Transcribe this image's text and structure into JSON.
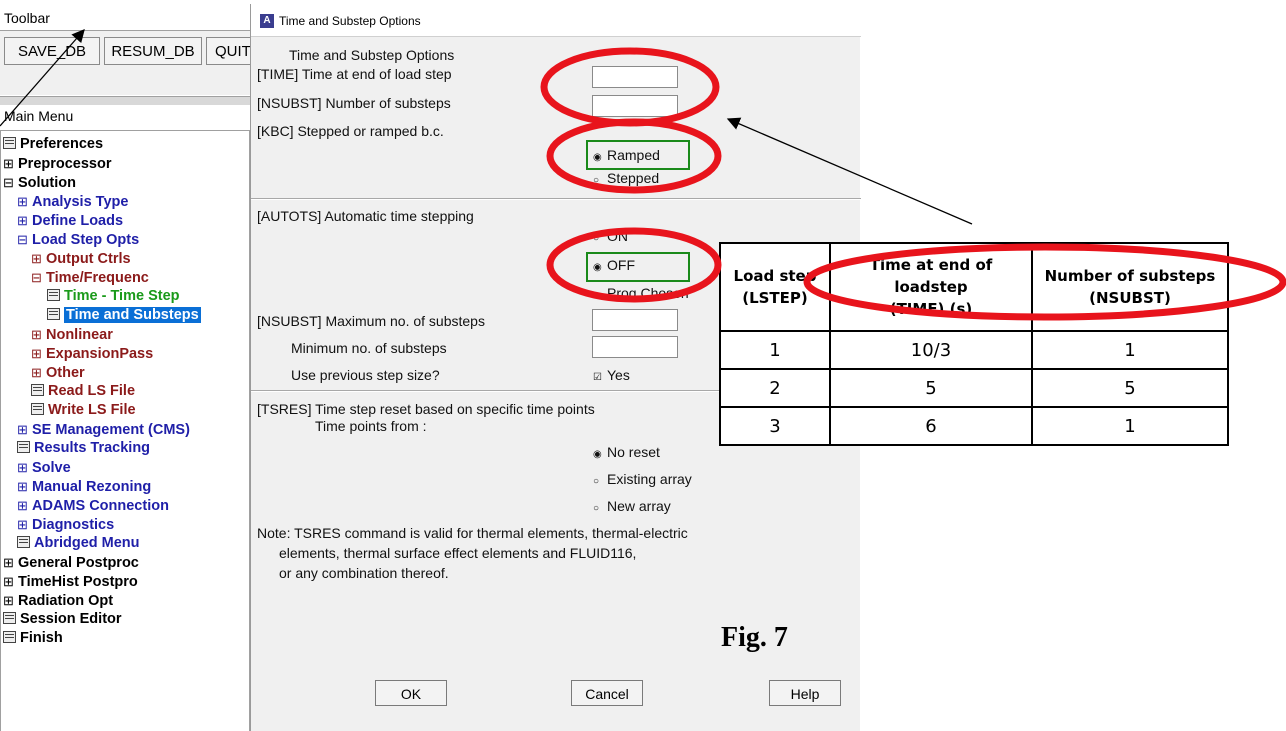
{
  "toolbar": {
    "title": "Toolbar",
    "buttons": [
      "SAVE_DB",
      "RESUM_DB",
      "QUIT"
    ]
  },
  "main_menu": {
    "title": "Main Menu",
    "items": [
      {
        "label": "Preferences"
      },
      {
        "label": "Preprocessor"
      },
      {
        "label": "Solution"
      },
      {
        "label": "Analysis Type"
      },
      {
        "label": "Define Loads"
      },
      {
        "label": "Load Step Opts"
      },
      {
        "label": "Output Ctrls"
      },
      {
        "label": "Time/Frequenc"
      },
      {
        "label": "Time - Time Step"
      },
      {
        "label": "Time and Substeps"
      },
      {
        "label": "Nonlinear"
      },
      {
        "label": "ExpansionPass"
      },
      {
        "label": "Other"
      },
      {
        "label": "Read LS File"
      },
      {
        "label": "Write LS File"
      },
      {
        "label": "SE Management (CMS)"
      },
      {
        "label": "Results Tracking"
      },
      {
        "label": "Solve"
      },
      {
        "label": "Manual Rezoning"
      },
      {
        "label": "ADAMS Connection"
      },
      {
        "label": "Diagnostics"
      },
      {
        "label": "Abridged Menu"
      },
      {
        "label": "General Postproc"
      },
      {
        "label": "TimeHist Postpro"
      },
      {
        "label": "Radiation Opt"
      },
      {
        "label": "Session Editor"
      },
      {
        "label": "Finish"
      }
    ]
  },
  "dialog": {
    "window_title": "Time and Substep Options",
    "header": "Time and Substep Options",
    "time_label": "[TIME]  Time at end of load step",
    "time_value": "",
    "nsubst_label": "[NSUBST]  Number of substeps",
    "nsubst_value": "",
    "kbc_label": "[KBC]     Stepped or ramped b.c.",
    "kbc_options": [
      "Ramped",
      "Stepped"
    ],
    "kbc_selected": "Ramped",
    "autots_label": "[AUTOTS] Automatic time stepping",
    "autots_options": [
      "ON",
      "OFF",
      "Prog Chosen"
    ],
    "autots_selected": "OFF",
    "max_substeps_label": "[NSUBST] Maximum no. of substeps",
    "max_substeps_value": "",
    "min_substeps_label": "Minimum no. of substeps",
    "min_substeps_value": "",
    "prev_step_label": "Use previous step size?",
    "prev_step_value": "Yes",
    "tsres_label": "[TSRES]  Time step reset based on specific time points",
    "time_points_label": "Time points from :",
    "tsres_options": [
      "No reset",
      "Existing array",
      "New array"
    ],
    "tsres_selected": "No reset",
    "note_lines": [
      "Note: TSRES command is valid for thermal elements, thermal-electric",
      "elements, thermal surface effect elements and FLUID116,",
      "or any combination thereof."
    ],
    "ok_label": "OK",
    "cancel_label": "Cancel",
    "help_label": "Help"
  },
  "load_step_table": {
    "headers": [
      [
        "Load step",
        "(LSTEP)"
      ],
      [
        "Time at end of loadstep",
        "(TIME)  (s)"
      ],
      [
        "Number of substeps",
        "(NSUBST)"
      ]
    ],
    "rows": [
      [
        "1",
        "10/3",
        "1"
      ],
      [
        "2",
        "5",
        "5"
      ],
      [
        "3",
        "6",
        "1"
      ]
    ]
  },
  "caption": "Fig. 7",
  "colors": {
    "annotation_red": "#e8141c",
    "highlight_green": "#1a8a1a",
    "selection_blue": "#0a6fd6"
  }
}
